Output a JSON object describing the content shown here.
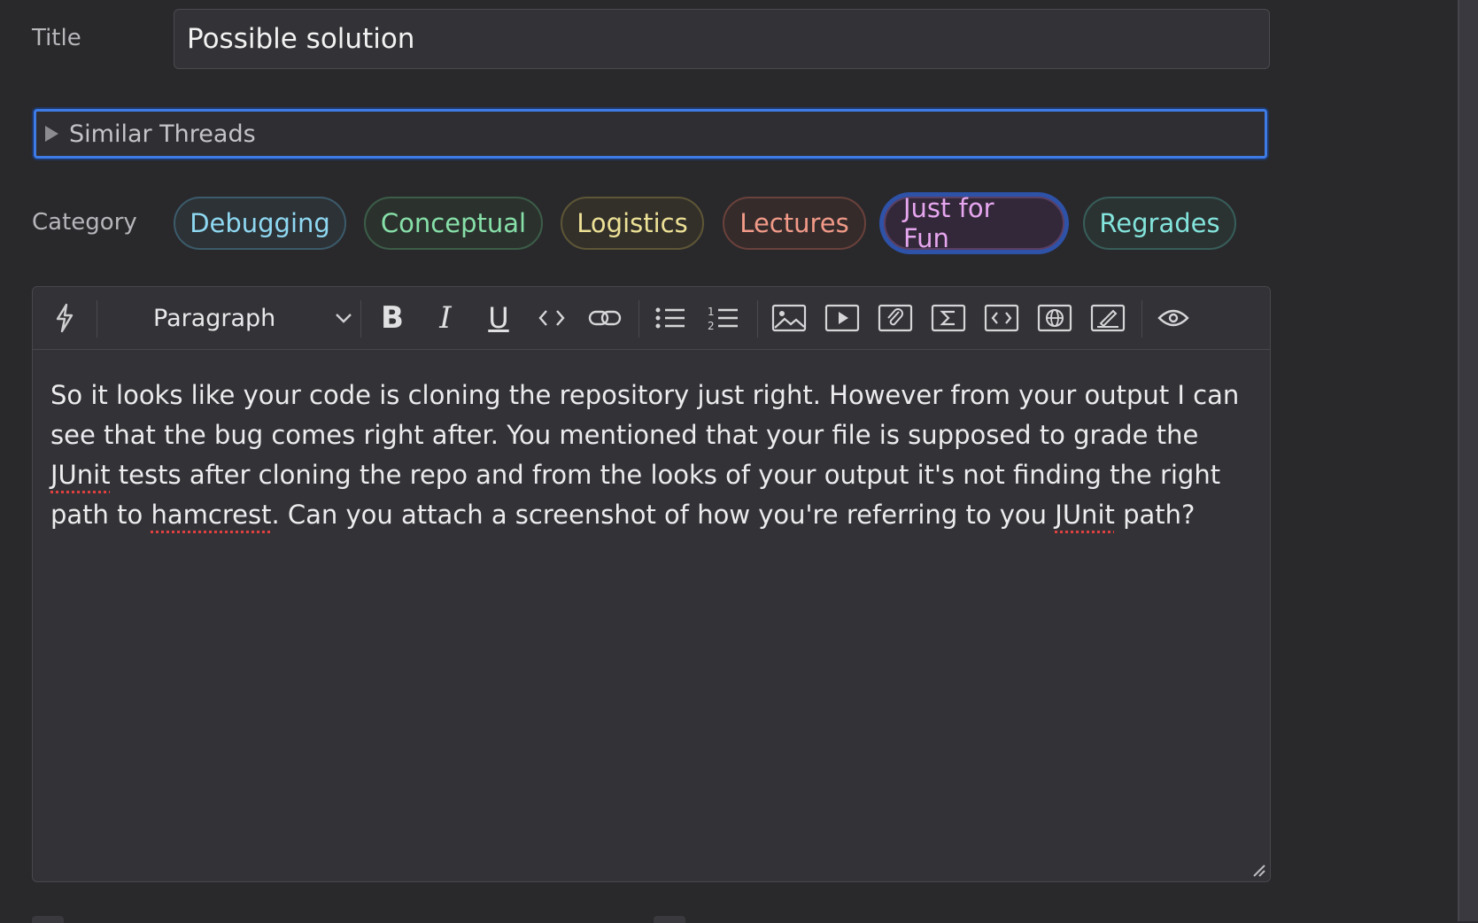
{
  "form": {
    "title_label": "Title",
    "title_value": "Possible solution",
    "similar_threads_label": "Similar Threads",
    "category_label": "Category",
    "categories": [
      {
        "label": "Debugging",
        "color": "#8fd8f2",
        "selected": false
      },
      {
        "label": "Conceptual",
        "color": "#87e0a8",
        "selected": false
      },
      {
        "label": "Logistics",
        "color": "#ede196",
        "selected": false
      },
      {
        "label": "Lectures",
        "color": "#f19a88",
        "selected": false
      },
      {
        "label": "Just for Fun",
        "color": "#e6a6ef",
        "selected": true
      },
      {
        "label": "Regrades",
        "color": "#83e4dc",
        "selected": false
      }
    ]
  },
  "editor": {
    "block_format": "Paragraph",
    "toolbar_icons": [
      "lightning-icon",
      "bold-icon",
      "italic-icon",
      "underline-icon",
      "inline-code-icon",
      "link-icon",
      "bulleted-list-icon",
      "numbered-list-icon",
      "image-icon",
      "video-icon",
      "attachment-icon",
      "math-icon",
      "code-block-icon",
      "web-embed-icon",
      "drawing-icon",
      "preview-eye-icon"
    ],
    "body_parts": {
      "p1": "So it looks like your code is cloning the repository just right. However from your output I can see that the bug comes right after. You mentioned that your file is supposed to grade the ",
      "w1": "JUnit",
      "p2": " tests after cloning the repo and from the looks of your output it's not finding the right path to ",
      "w2": "hamcrest",
      "p3": ". Can you attach a screenshot of how you're referring to you ",
      "w3": "JUnit",
      "p4": " path?"
    }
  },
  "colors": {
    "background": "#29292c",
    "focus_ring": "#3e7be6"
  }
}
